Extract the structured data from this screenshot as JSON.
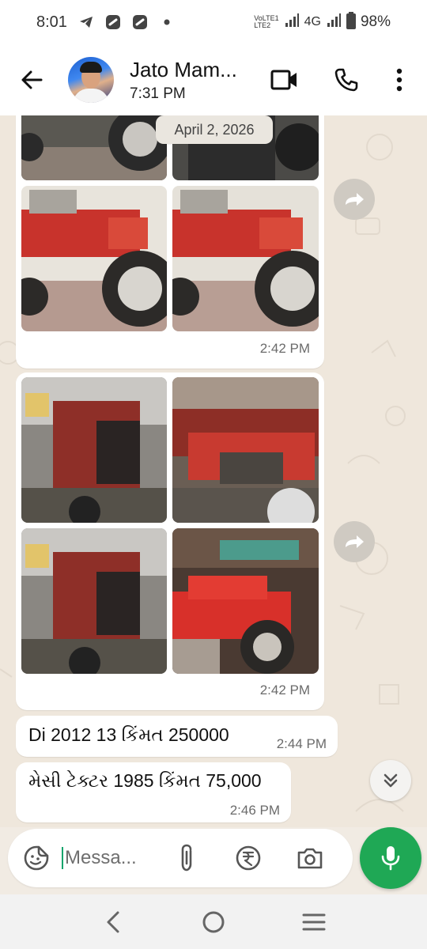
{
  "status_bar": {
    "time": "8:01",
    "signal_labels": [
      "VoLTE1",
      "LTE2"
    ],
    "network": "4G",
    "battery": "98%",
    "icons": [
      "telegram-icon",
      "app-icon",
      "app-icon",
      "dot-icon",
      "signal-icon",
      "signal-icon",
      "battery-icon"
    ]
  },
  "header": {
    "contact_name": "Jato Mam...",
    "last_seen": "7:31 PM",
    "icons": [
      "back-arrow-icon",
      "video-call-icon",
      "phone-icon",
      "more-vert-icon"
    ]
  },
  "chat": {
    "date_chip": "April 2, 2026",
    "messages": [
      {
        "type": "photo-grid",
        "time": "2:42 PM",
        "photos": 4
      },
      {
        "type": "photo-grid",
        "time": "2:42 PM",
        "photos": 4
      },
      {
        "type": "text",
        "text": "Di 2012 13  કિંમત 250000",
        "time": "2:44 PM"
      },
      {
        "type": "text",
        "text": "મેસી  ટેક્ટર 1985  કિંમત 75,000",
        "time": "2:46 PM"
      }
    ]
  },
  "input": {
    "placeholder": "Messa..."
  },
  "colors": {
    "accent_green": "#1fa855",
    "chat_bg": "#efe7dc",
    "bubble_bg": "#ffffff",
    "tractor_red": "#c8332c"
  }
}
